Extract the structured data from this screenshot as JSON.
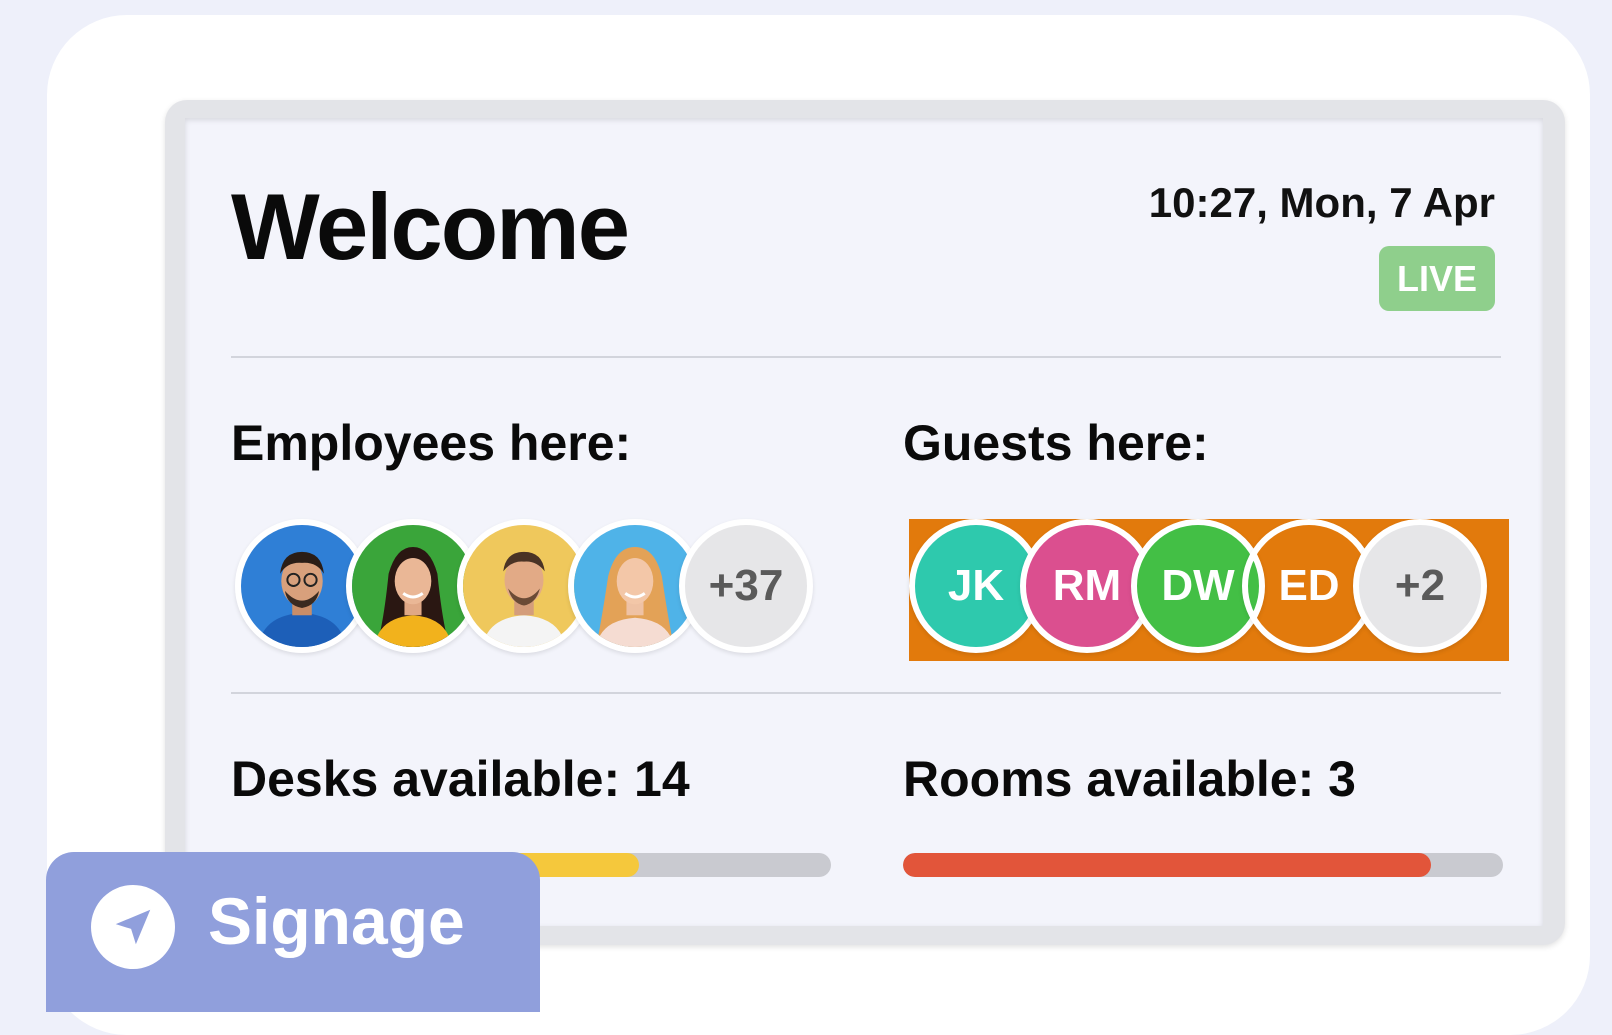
{
  "header": {
    "title": "Welcome",
    "datetime": "10:27, Mon, 7 Apr",
    "status_badge": "LIVE"
  },
  "employees": {
    "label": "Employees here:",
    "avatars": [
      {
        "kind": "photo",
        "bg": "#2f7fd6"
      },
      {
        "kind": "photo",
        "bg": "#3aa53a"
      },
      {
        "kind": "photo",
        "bg": "#efc85c"
      },
      {
        "kind": "photo",
        "bg": "#4fb3e8"
      }
    ],
    "more_count": "+37"
  },
  "guests": {
    "label": "Guests here:",
    "avatars": [
      {
        "initials": "JK",
        "color": "#e27a0c"
      },
      {
        "initials": "RM",
        "color": "#2ec9ad"
      },
      {
        "initials": "DW",
        "color": "#db4f8f"
      },
      {
        "initials": "ED",
        "color": "#43bf45"
      }
    ],
    "more_count": "+2"
  },
  "desks": {
    "label": "Desks available: 14",
    "fill_fraction": 0.68,
    "color": "#f5c83c"
  },
  "rooms": {
    "label": "Rooms available: 3",
    "fill_fraction": 0.88,
    "color": "#e2553a"
  },
  "signage": {
    "label": "Signage",
    "icon": "navigation-arrow-icon"
  }
}
